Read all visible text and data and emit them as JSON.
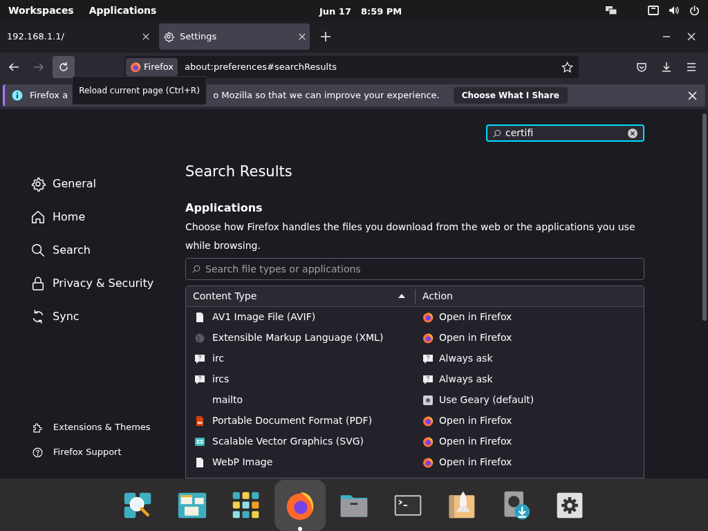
{
  "top_bar": {
    "menus": [
      "Workspaces",
      "Applications"
    ],
    "date": "Jun 17",
    "time": "8:59 PM"
  },
  "tabs": [
    {
      "title": "192.168.1.1/",
      "selected": false,
      "kind": "page"
    },
    {
      "title": "Settings",
      "selected": true,
      "kind": "settings"
    }
  ],
  "nav": {
    "identity": "Firefox",
    "url": "about:preferences#searchResults",
    "forward_disabled": true
  },
  "tooltip": "Reload current page (Ctrl+R)",
  "notification": {
    "text_before": "Firefox a",
    "text_after": "o Mozilla so that we can improve your experience.",
    "button": "Choose What I Share"
  },
  "settings_search": {
    "value": "certifi"
  },
  "sidebar": {
    "items": [
      {
        "label": "General",
        "kind": "gear"
      },
      {
        "label": "Home",
        "kind": "home"
      },
      {
        "label": "Search",
        "kind": "search"
      },
      {
        "label": "Privacy & Security",
        "kind": "lock"
      },
      {
        "label": "Sync",
        "kind": "sync"
      }
    ],
    "footer": [
      {
        "label": "Extensions & Themes",
        "kind": "puzzle"
      },
      {
        "label": "Firefox Support",
        "kind": "help"
      }
    ]
  },
  "main": {
    "title": "Search Results",
    "section": "Applications",
    "description": "Choose how Firefox handles the files you download from the web or the applications you use while browsing.",
    "filter": {
      "placeholder": "Search file types or applications"
    },
    "table": {
      "columns": [
        "Content Type",
        "Action"
      ],
      "rows": [
        {
          "type": {
            "text": "AV1 Image File (AVIF)",
            "kind": "file"
          },
          "action": {
            "text": "Open in Firefox",
            "kind": "firefox"
          }
        },
        {
          "type": {
            "text": "Extensible Markup Language (XML)",
            "kind": "globe"
          },
          "action": {
            "text": "Open in Firefox",
            "kind": "firefox"
          }
        },
        {
          "type": {
            "text": "irc",
            "kind": "question"
          },
          "action": {
            "text": "Always ask",
            "kind": "question"
          }
        },
        {
          "type": {
            "text": "ircs",
            "kind": "question"
          },
          "action": {
            "text": "Always ask",
            "kind": "question"
          }
        },
        {
          "type": {
            "text": "mailto",
            "kind": "blank"
          },
          "action": {
            "text": "Use Geary (default)",
            "kind": "app"
          }
        },
        {
          "type": {
            "text": "Portable Document Format (PDF)",
            "kind": "pdf"
          },
          "action": {
            "text": "Open in Firefox",
            "kind": "firefox"
          }
        },
        {
          "type": {
            "text": "Scalable Vector Graphics (SVG)",
            "kind": "image"
          },
          "action": {
            "text": "Open in Firefox",
            "kind": "firefox"
          }
        },
        {
          "type": {
            "text": "WebP Image",
            "kind": "file"
          },
          "action": {
            "text": "Open in Firefox",
            "kind": "firefox"
          }
        }
      ]
    }
  },
  "dock": [
    {
      "kind": "search",
      "selected": false
    },
    {
      "kind": "windows",
      "selected": false
    },
    {
      "kind": "grid",
      "selected": false
    },
    {
      "kind": "firefox",
      "selected": true
    },
    {
      "kind": "folder",
      "selected": false
    },
    {
      "kind": "terminal",
      "selected": false
    },
    {
      "kind": "rocket",
      "selected": false
    },
    {
      "kind": "installer",
      "selected": false
    },
    {
      "kind": "settings",
      "selected": false
    }
  ]
}
